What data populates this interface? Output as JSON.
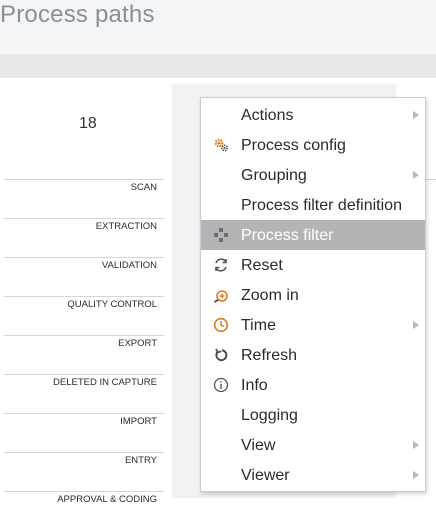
{
  "page": {
    "title": "Process paths"
  },
  "summary": {
    "count": "18"
  },
  "rows": [
    {
      "label": "SCAN"
    },
    {
      "label": "EXTRACTION"
    },
    {
      "label": "VALIDATION"
    },
    {
      "label": "QUALITY CONTROL"
    },
    {
      "label": "EXPORT"
    },
    {
      "label": "DELETED IN CAPTURE"
    },
    {
      "label": "IMPORT"
    },
    {
      "label": "ENTRY"
    },
    {
      "label": "APPROVAL & CODING"
    }
  ],
  "menu": {
    "items": [
      {
        "label": "Actions",
        "icon": "none",
        "submenu": true
      },
      {
        "label": "Process config",
        "icon": "gears-icon",
        "submenu": false
      },
      {
        "label": "Grouping",
        "icon": "none",
        "submenu": true
      },
      {
        "label": "Process filter definition",
        "icon": "none",
        "submenu": false
      },
      {
        "label": "Process filter",
        "icon": "process-filter-icon",
        "submenu": false,
        "selected": true
      },
      {
        "label": "Reset",
        "icon": "reset-icon",
        "submenu": false
      },
      {
        "label": "Zoom in",
        "icon": "zoom-in-icon",
        "submenu": false
      },
      {
        "label": "Time",
        "icon": "clock-icon",
        "submenu": true
      },
      {
        "label": "Refresh",
        "icon": "refresh-icon",
        "submenu": false
      },
      {
        "label": "Info",
        "icon": "info-icon",
        "submenu": false
      },
      {
        "label": "Logging",
        "icon": "none",
        "submenu": false
      },
      {
        "label": "View",
        "icon": "none",
        "submenu": true
      },
      {
        "label": "Viewer",
        "icon": "none",
        "submenu": true
      }
    ]
  },
  "colors": {
    "selected_bg": "#b3b4b6",
    "accent_orange": "#e07b1a"
  }
}
